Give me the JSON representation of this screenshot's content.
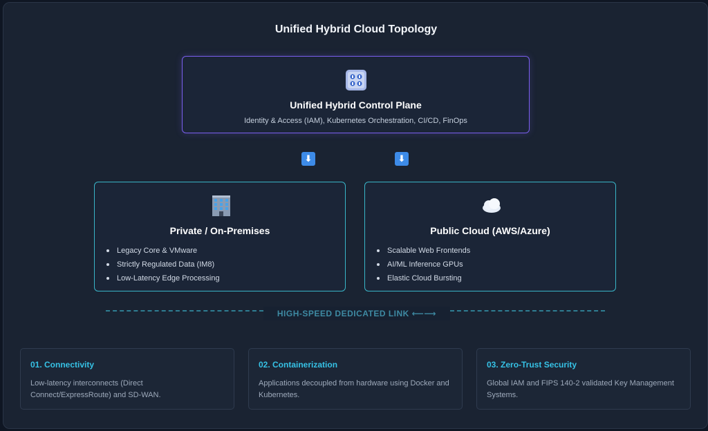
{
  "title": "Unified Hybrid Cloud Topology",
  "control_plane": {
    "icon": "control-panel-icon",
    "heading": "Unified Hybrid Control Plane",
    "subtitle": "Identity & Access (IAM), Kubernetes Orchestration, CI/CD, FinOps"
  },
  "arrows": {
    "glyph": "⬇",
    "color": "#3d8be8"
  },
  "private": {
    "icon": "office-building-icon",
    "heading": "Private / On-Premises",
    "items": [
      "Legacy Core & VMware",
      "Strictly Regulated Data (IM8)",
      "Low-Latency Edge Processing"
    ]
  },
  "public": {
    "icon": "cloud-icon",
    "heading": "Public Cloud (AWS/Azure)",
    "items": [
      "Scalable Web Frontends",
      "AI/ML Inference GPUs",
      "Elastic Cloud Bursting"
    ]
  },
  "link": {
    "label": "HIGH-SPEED DEDICATED LINK ⟵⟶"
  },
  "cards": [
    {
      "heading": "01. Connectivity",
      "text": "Low-latency interconnects (Direct Connect/ExpressRoute) and SD-WAN."
    },
    {
      "heading": "02. Containerization",
      "text": "Applications decoupled from hardware using Docker and Kubernetes."
    },
    {
      "heading": "03. Zero-Trust Security",
      "text": "Global IAM and FIPS 140-2 validated Key Management Systems."
    }
  ],
  "colors": {
    "control_border": "#7b5ff0",
    "env_border": "#39b6c9",
    "card_heading": "#36c2e6",
    "link": "#2f7d92"
  }
}
